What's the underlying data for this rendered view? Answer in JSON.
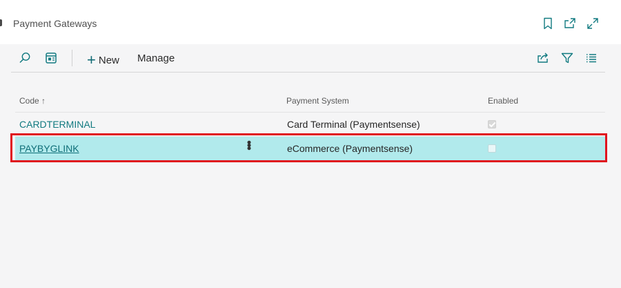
{
  "header": {
    "title": "Payment Gateways",
    "icons": [
      "bookmark-icon",
      "open-in-new-window-icon",
      "expand-icon"
    ]
  },
  "toolbar": {
    "search_icon": "search-icon",
    "edit_list_icon": "edit-list-icon",
    "new_label": "New",
    "manage_label": "Manage",
    "right_icons": [
      "share-icon",
      "filter-icon",
      "list-view-icon"
    ]
  },
  "table": {
    "columns": [
      {
        "label": "Code",
        "sort": "↑"
      },
      {
        "label": "Payment System"
      },
      {
        "label": "Enabled"
      }
    ],
    "rows": [
      {
        "code": "CARDTERMINAL",
        "payment_system": "Card Terminal (Paymentsense)",
        "enabled": true,
        "selected": false
      },
      {
        "code": "PAYBYGLINK",
        "payment_system": "eCommerce (Paymentsense)",
        "enabled": false,
        "selected": true
      }
    ]
  },
  "colors": {
    "accent": "#117a80",
    "selected_row": "#b1eaec",
    "highlight_border": "#e0141e",
    "background": "#f5f5f6"
  }
}
